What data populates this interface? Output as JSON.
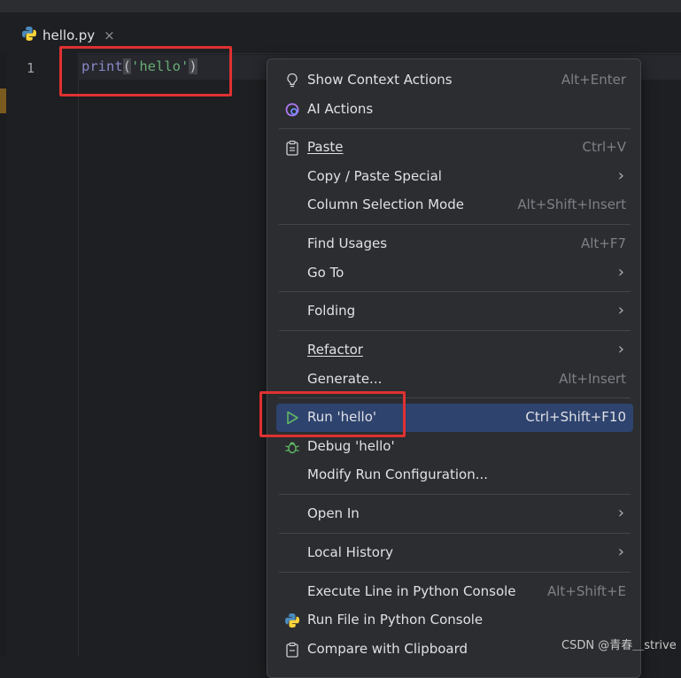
{
  "editor": {
    "tab": {
      "filename": "hello.py",
      "close_glyph": "×"
    },
    "line_number": "1",
    "code": {
      "keyword": "print",
      "open_paren": "(",
      "string": "'hello'",
      "close_paren": ")"
    }
  },
  "menu": {
    "items": [
      {
        "label": "Show Context Actions",
        "shortcut": "Alt+Enter",
        "icon": "lightbulb-icon"
      },
      {
        "label": "AI Actions",
        "shortcut": "",
        "icon": "ai-assistant-icon"
      },
      {
        "label": "Paste",
        "shortcut": "Ctrl+V",
        "icon": "clipboard-icon"
      },
      {
        "label": "Copy / Paste Special",
        "shortcut": "",
        "submenu": true
      },
      {
        "label": "Column Selection Mode",
        "shortcut": "Alt+Shift+Insert"
      },
      {
        "label": "Find Usages",
        "shortcut": "Alt+F7"
      },
      {
        "label": "Go To",
        "shortcut": "",
        "submenu": true
      },
      {
        "label": "Folding",
        "shortcut": "",
        "submenu": true
      },
      {
        "label": "Refactor",
        "shortcut": "",
        "submenu": true
      },
      {
        "label": "Generate...",
        "shortcut": "Alt+Insert"
      },
      {
        "label": "Run 'hello'",
        "shortcut": "Ctrl+Shift+F10",
        "icon": "run-icon",
        "selected": true
      },
      {
        "label": "Debug 'hello'",
        "shortcut": "",
        "icon": "debug-bug-icon"
      },
      {
        "label": "Modify Run Configuration...",
        "shortcut": ""
      },
      {
        "label": "Open In",
        "shortcut": "",
        "submenu": true
      },
      {
        "label": "Local History",
        "shortcut": "",
        "submenu": true
      },
      {
        "label": "Execute Line in Python Console",
        "shortcut": "Alt+Shift+E"
      },
      {
        "label": "Run File in Python Console",
        "shortcut": "",
        "icon": "python-icon"
      },
      {
        "label": "Compare with Clipboard",
        "shortcut": "",
        "icon": "compare-clipboard-icon"
      }
    ],
    "chevron_glyph": "›"
  },
  "watermark": "CSDN @青春＿strive",
  "colors": {
    "highlight_box": "#e03131",
    "selection": "#2e436e",
    "menu_background": "#2b2d30",
    "editor_background": "#1e1f22"
  }
}
